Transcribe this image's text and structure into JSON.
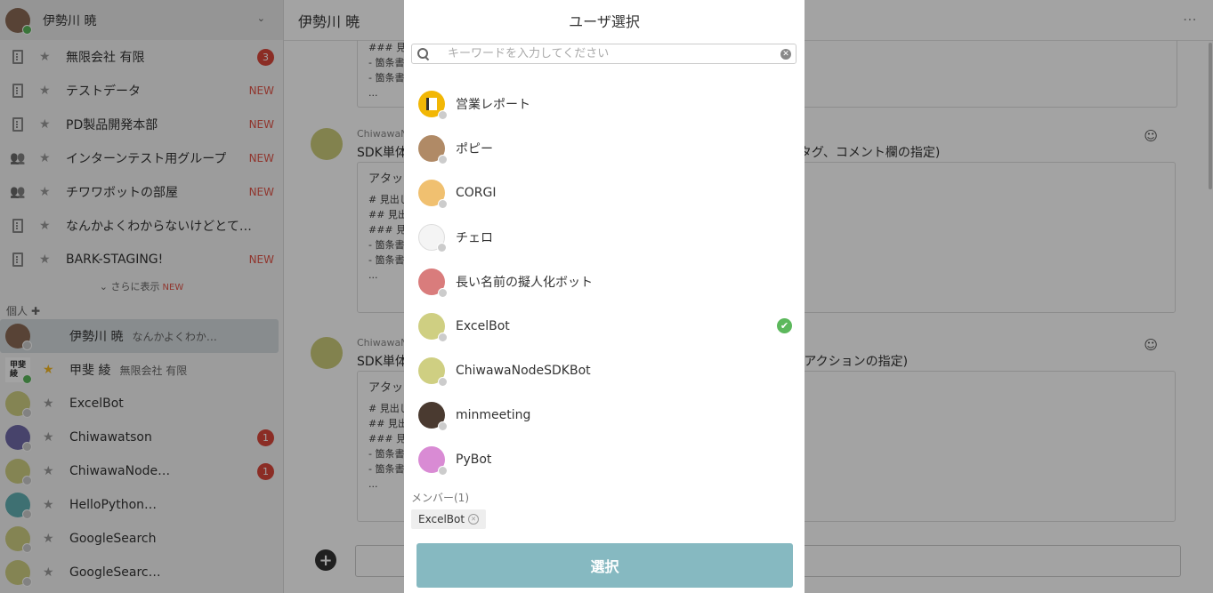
{
  "sidebar": {
    "user_name": "伊勢川 暁",
    "groups": [
      {
        "label": "無限会社 有限",
        "icon": "building-icon",
        "badge": "3",
        "new": ""
      },
      {
        "label": "テストデータ",
        "icon": "building-icon",
        "badge": "",
        "new": "NEW"
      },
      {
        "label": "PD製品開発本部",
        "icon": "building-icon",
        "badge": "",
        "new": "NEW"
      },
      {
        "label": "インターンテスト用グループ",
        "icon": "people-icon",
        "badge": "",
        "new": "NEW"
      },
      {
        "label": "チワワボットの部屋",
        "icon": "people-icon",
        "badge": "",
        "new": "NEW"
      },
      {
        "label": "なんかよくわからないけどとて…",
        "icon": "building-icon",
        "badge": "",
        "new": ""
      },
      {
        "label": "BARK-STAGING!",
        "icon": "building-icon",
        "badge": "",
        "new": "NEW"
      }
    ],
    "more_label": "さらに表示",
    "more_new": "NEW",
    "personal_label": "個人",
    "people": [
      {
        "label": "伊勢川 暁",
        "sub": "なんかよくわか…",
        "badge": ""
      },
      {
        "label": "甲斐 綾",
        "sub": "無限会社 有限",
        "badge": ""
      },
      {
        "label": "ExcelBot",
        "sub": "",
        "badge": ""
      },
      {
        "label": "Chiwawatson",
        "sub": "",
        "badge": "1"
      },
      {
        "label": "ChiwawaNode…",
        "sub": "",
        "badge": "1"
      },
      {
        "label": "HelloPython…",
        "sub": "",
        "badge": ""
      },
      {
        "label": "GoogleSearch",
        "sub": "",
        "badge": ""
      },
      {
        "label": "GoogleSearc…",
        "sub": "",
        "badge": ""
      }
    ],
    "avatar_badge_text": "甲斐\n綾"
  },
  "main": {
    "title": "伊勢川 暁",
    "top_quote": [
      "### 見出し",
      "- 箇条書き",
      "- 箇条書き",
      "..."
    ],
    "messages": [
      {
        "author": "ChiwawaN",
        "title": "SDK単体",
        "title_tail": "タグ、コメント欄の指定)",
        "box_head": "アタッ",
        "lines": [
          "# 見出し",
          "## 見出し",
          "### 見出",
          "- 箇条書",
          "- 箇条書",
          "..."
        ]
      },
      {
        "author": "ChiwawaN",
        "title": "SDK単体",
        "title_tail": "(アクションの指定)",
        "box_head": "アタッ",
        "lines": [
          "# 見出し",
          "## 見出",
          "### 見出",
          "- 箇条書",
          "- 箇条書",
          "..."
        ]
      }
    ]
  },
  "modal": {
    "title": "ユーザ選択",
    "search_placeholder": "キーワードを入力してください",
    "users": [
      {
        "name": "営業レポート",
        "avatar_color": "#f2b705",
        "selected": false
      },
      {
        "name": "ポピー",
        "avatar_color": "#b08a66",
        "selected": false
      },
      {
        "name": "CORGI",
        "avatar_color": "#f0c070",
        "selected": false
      },
      {
        "name": "チェロ",
        "avatar_color": "#f4f4f4",
        "selected": false
      },
      {
        "name": "長い名前の擬人化ボット",
        "avatar_color": "#d97c7c",
        "selected": false
      },
      {
        "name": "ExcelBot",
        "avatar_color": "#cfcf82",
        "selected": true
      },
      {
        "name": "ChiwawaNodeSDKBot",
        "avatar_color": "#cfcf82",
        "selected": false
      },
      {
        "name": "minmeeting",
        "avatar_color": "#4a3a30",
        "selected": false
      },
      {
        "name": "PyBot",
        "avatar_color": "#d98bd4",
        "selected": false
      }
    ],
    "members_label": "メンバー(1)",
    "member_chip": "ExcelBot",
    "select_button": "選択",
    "colors": {
      "accent": "#86b9c1",
      "check": "#5cb85c",
      "badge": "#d9473b",
      "new": "#e25549"
    }
  }
}
